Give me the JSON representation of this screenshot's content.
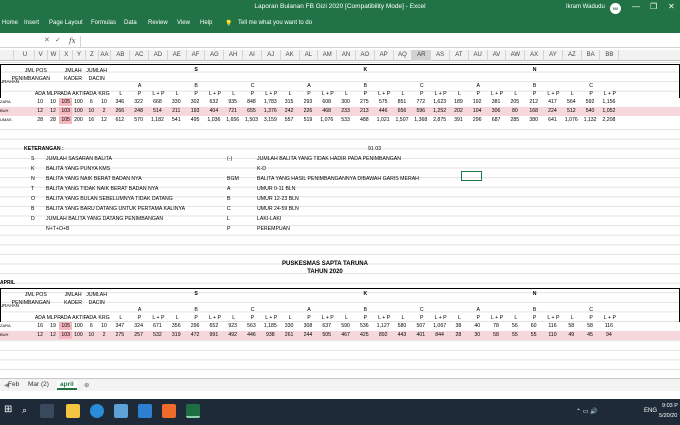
{
  "window": {
    "title": "Laporan Bulanan FB Gizi 2020  [Compatibility Mode]  -  Excel",
    "user": "Ikram Wadudu",
    "avatar": "IW",
    "minimize": "—",
    "restore": "❐",
    "close": "✕"
  },
  "menu": [
    "Home",
    "Insert",
    "Page Layout",
    "Formulas",
    "Data",
    "Review",
    "View",
    "Help"
  ],
  "tellme": "Tell me what you want to do",
  "formula": {
    "fx": "fx"
  },
  "columns": [
    "U",
    "V",
    "W",
    "X",
    "Y",
    "Z",
    "AA",
    "AB",
    "AC",
    "AD",
    "AE",
    "AF",
    "AG",
    "AH",
    "AI",
    "AJ",
    "AK",
    "AL",
    "AM",
    "AN",
    "AO",
    "AP",
    "AQ",
    "AR",
    "AS",
    "AT",
    "AU",
    "AV",
    "AW",
    "AX",
    "AY",
    "AZ",
    "BA",
    "BB"
  ],
  "selected_column": "AR",
  "table1": {
    "h_jml_pos": "JML POS",
    "h_penimbangan": "PENIMBANGAN",
    "h_jmlah": "JMLAH",
    "h_kader": "KADER",
    "h_jumlah": "JUMLAH",
    "h_dacin": "DACIN",
    "h_s": "S",
    "h_k": "K",
    "h_n": "N",
    "h_a": "A",
    "h_b": "B",
    "h_c": "C",
    "h_urahan": "URAHAN",
    "sub": [
      "ADA",
      "MLPR",
      "ADA",
      "AKTIF",
      "ADA",
      "KRG"
    ],
    "lp": [
      "L",
      "P",
      "L + P"
    ],
    "rows": [
      {
        "name": "ZARA",
        "v": [
          "10",
          "10",
          "105",
          "100",
          "6",
          "10",
          "346",
          "322",
          "668",
          "330",
          "302",
          "632",
          "935",
          "848",
          "1,783",
          "315",
          "293",
          "608",
          "300",
          "275",
          "575",
          "851",
          "772",
          "1,623",
          "189",
          "192",
          "381",
          "205",
          "212",
          "417",
          "564",
          "592",
          "1,156"
        ]
      },
      {
        "name": "BUH",
        "v": [
          "12",
          "12",
          "103",
          "100",
          "10",
          "2",
          "266",
          "248",
          "514",
          "211",
          "193",
          "404",
          "721",
          "655",
          "1,376",
          "242",
          "226",
          "468",
          "233",
          "213",
          "446",
          "656",
          "596",
          "1,252",
          "202",
          "104",
          "306",
          "80",
          "168",
          "224",
          "512",
          "540",
          "1,052"
        ]
      },
      {
        "name": "UMAS",
        "v": [
          "28",
          "28",
          "105",
          "200",
          "16",
          "12",
          "612",
          "570",
          "1,182",
          "541",
          "495",
          "1,036",
          "1,656",
          "1,503",
          "3,159",
          "557",
          "519",
          "1,076",
          "533",
          "488",
          "1,021",
          "1,507",
          "1,368",
          "2,875",
          "391",
          "296",
          "687",
          "285",
          "380",
          "641",
          "1,076",
          "1,132",
          "2,208"
        ]
      }
    ]
  },
  "keterangan": {
    "title": "KETERANGAN :",
    "date": "91 03",
    "left": [
      [
        "S",
        "JUMLAH SASARAN BALITA"
      ],
      [
        "K",
        "BALITA YANG PUNYA KMS"
      ],
      [
        "N",
        "BALITA YANG NAIK BERAT BADAN NYA"
      ],
      [
        "T",
        "BALITA YANG TIDAK NAIK BERAT BADAN NYA"
      ],
      [
        "O",
        "BALITA YANG BULAN SEBELUMNYA TIDAK DATANG"
      ],
      [
        "B",
        "BALITA YANG BARU DATANG UNTUK PERTAMA KALINYA"
      ],
      [
        "D",
        "JUMLAH BALITA YANG DATANG PENIMBANGAN"
      ],
      [
        "",
        "N+T+O+B"
      ]
    ],
    "right": [
      [
        "(-)",
        "JUMLAH BALITA YANG TIDAK HADIR PADA PENIMBANGAN"
      ],
      [
        "",
        "K-D"
      ],
      [
        "BGM",
        "BALITA YANG HASIL PENIMBANGANNYA DIBAWAH GARIS MERAH"
      ],
      [
        "A",
        "UMUR 0-11 BLN"
      ],
      [
        "B",
        "UMUR 12-23 BLN"
      ],
      [
        "C",
        "UMUR 24-59 BLN"
      ],
      [
        "L",
        "LAKI-LAKI"
      ],
      [
        "P",
        "PEREMPUAN"
      ]
    ]
  },
  "section2": {
    "title": "PUSKESMAS SAPTA TARUNA",
    "year": "TAHUN 2020",
    "label": "APRIL"
  },
  "table2": {
    "rows": [
      {
        "name": "ZARA",
        "v": [
          "16",
          "19",
          "105",
          "100",
          "6",
          "10",
          "347",
          "324",
          "671",
          "356",
          "296",
          "652",
          "923",
          "563",
          "1,185",
          "330",
          "308",
          "637",
          "590",
          "536",
          "1,127",
          "580",
          "507",
          "1,067",
          "38",
          "40",
          "78",
          "56",
          "60",
          "116",
          "58",
          "58",
          "116"
        ]
      },
      {
        "name": "BUH",
        "v": [
          "12",
          "12",
          "103",
          "100",
          "10",
          "2",
          "275",
          "257",
          "532",
          "319",
          "472",
          "991",
          "492",
          "446",
          "938",
          "261",
          "244",
          "505",
          "467",
          "425",
          "892",
          "443",
          "401",
          "844",
          "28",
          "30",
          "58",
          "55",
          "55",
          "110",
          "49",
          "45",
          "94"
        ]
      }
    ]
  },
  "sheets": [
    "Feb",
    "Mar (2)",
    "april"
  ],
  "active_sheet": "april",
  "clock": {
    "time": "9:03 P",
    "date": "5/20/20"
  },
  "lang": "ENG"
}
